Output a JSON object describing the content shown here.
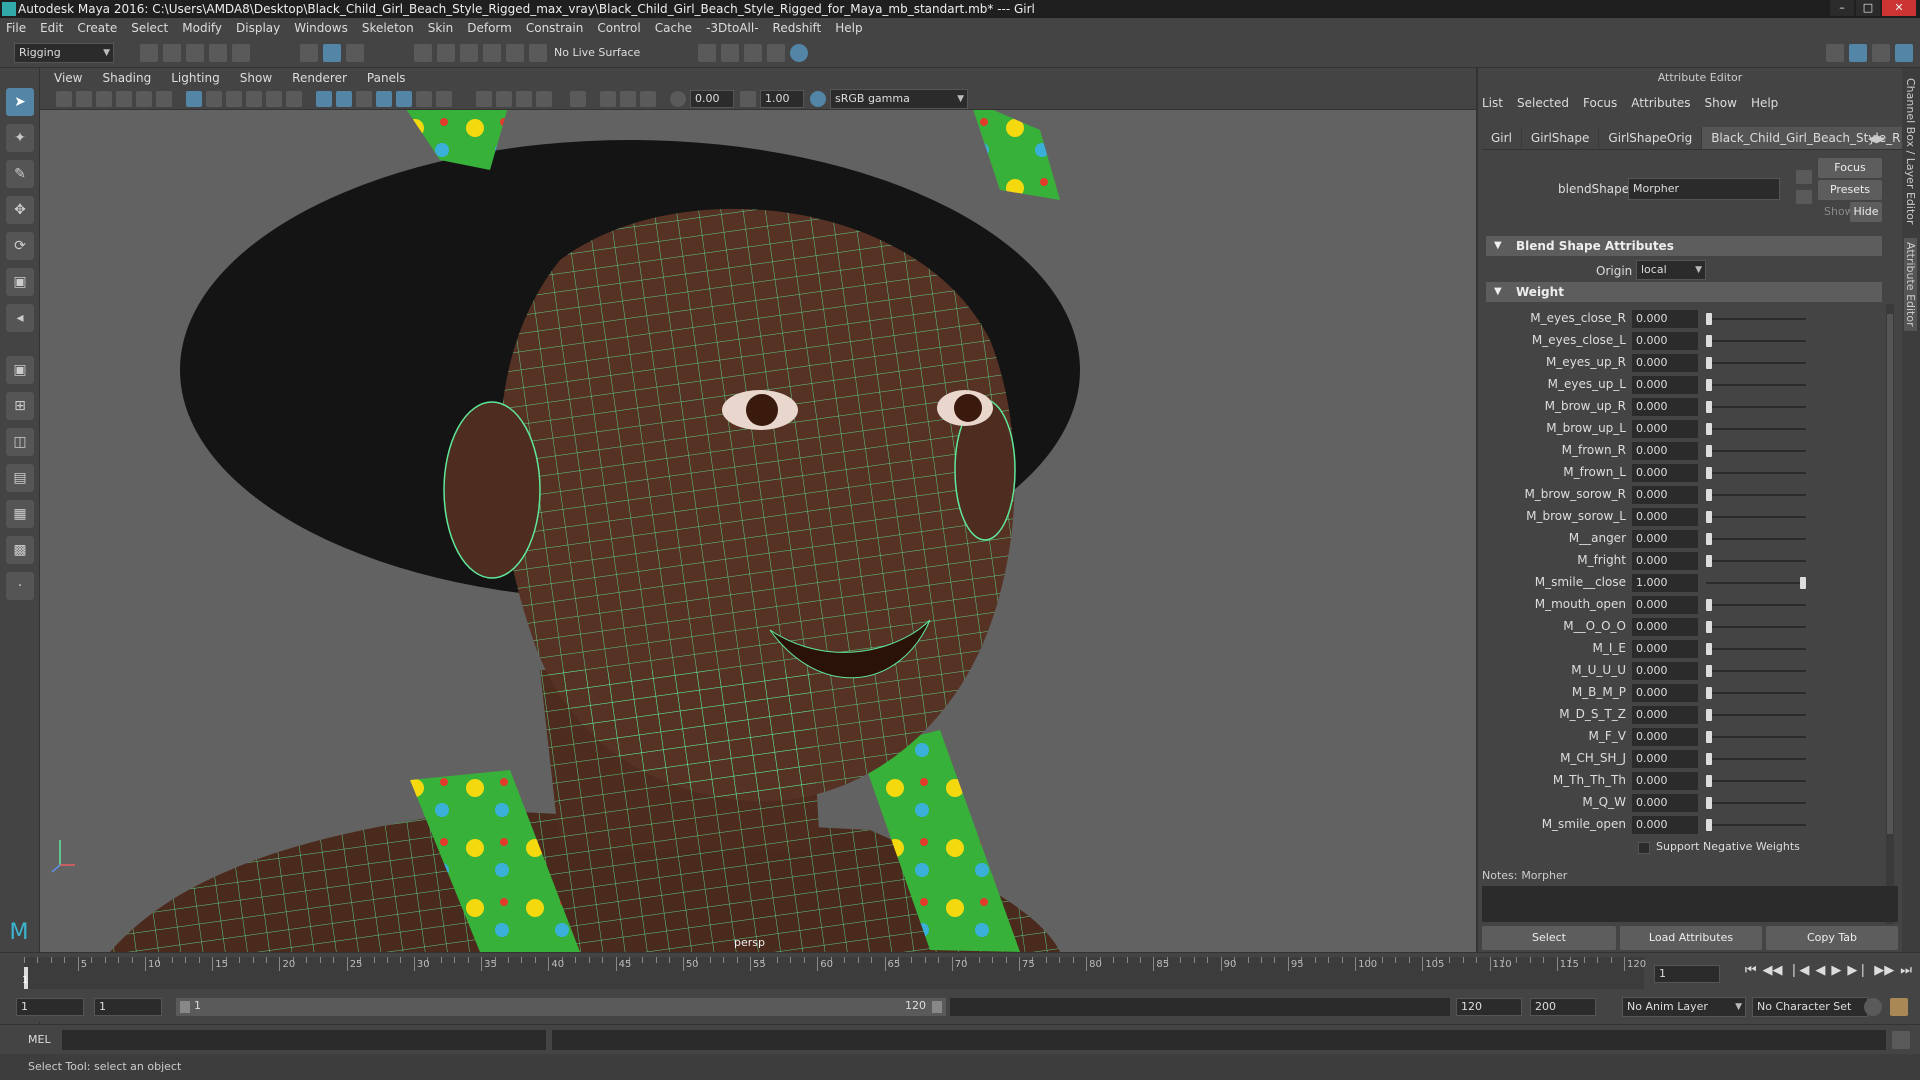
{
  "window": {
    "title": "Autodesk Maya 2016: C:\\Users\\AMDA8\\Desktop\\Black_Child_Girl_Beach_Style_Rigged_max_vray\\Black_Child_Girl_Beach_Style_Rigged_for_Maya_mb_standart.mb*   ---   Girl"
  },
  "menubar": [
    "File",
    "Edit",
    "Create",
    "Select",
    "Modify",
    "Display",
    "Windows",
    "Skeleton",
    "Skin",
    "Deform",
    "Constrain",
    "Control",
    "Cache",
    "-3DtoAll-",
    "Redshift",
    "Help"
  ],
  "shelf": {
    "mode": "Rigging",
    "live_surface": "No Live Surface"
  },
  "viewport": {
    "menu": [
      "View",
      "Shading",
      "Lighting",
      "Show",
      "Renderer",
      "Panels"
    ],
    "exposure": "0.00",
    "gamma": "1.00",
    "color_space": "sRGB gamma",
    "camera": "persp"
  },
  "attribute_editor": {
    "header": "Attribute Editor",
    "menu": [
      "List",
      "Selected",
      "Focus",
      "Attributes",
      "Show",
      "Help"
    ],
    "tabs": [
      "Girl",
      "GirlShape",
      "GirlShapeOrig",
      "Black_Child_Girl_Beach_Style_R"
    ],
    "focus_label": "Focus",
    "presets_label": "Presets",
    "show_label": "Show",
    "hide_label": "Hide",
    "node_type_label": "blendShape:",
    "node_name": "Morpher",
    "section_blend": "Blend Shape Attributes",
    "origin_label": "Origin",
    "origin_value": "local",
    "section_weight": "Weight",
    "weights": [
      {
        "name": "M_eyes_close_R",
        "value": "0.000",
        "level": 0
      },
      {
        "name": "M_eyes_close_L",
        "value": "0.000",
        "level": 0
      },
      {
        "name": "M_eyes_up_R",
        "value": "0.000",
        "level": 0
      },
      {
        "name": "M_eyes_up_L",
        "value": "0.000",
        "level": 0
      },
      {
        "name": "M_brow_up_R",
        "value": "0.000",
        "level": 0
      },
      {
        "name": "M_brow_up_L",
        "value": "0.000",
        "level": 0
      },
      {
        "name": "M_frown_R",
        "value": "0.000",
        "level": 0
      },
      {
        "name": "M_frown_L",
        "value": "0.000",
        "level": 0
      },
      {
        "name": "M_brow_sorow_R",
        "value": "0.000",
        "level": 0
      },
      {
        "name": "M_brow_sorow_L",
        "value": "0.000",
        "level": 0
      },
      {
        "name": "M__anger",
        "value": "0.000",
        "level": 0
      },
      {
        "name": "M_fright",
        "value": "0.000",
        "level": 0
      },
      {
        "name": "M_smile__close",
        "value": "1.000",
        "level": 1
      },
      {
        "name": "M_mouth_open",
        "value": "0.000",
        "level": 0
      },
      {
        "name": "M__O_O_O",
        "value": "0.000",
        "level": 0
      },
      {
        "name": "M_I_E",
        "value": "0.000",
        "level": 0
      },
      {
        "name": "M_U_U_U",
        "value": "0.000",
        "level": 0
      },
      {
        "name": "M_B_M_P",
        "value": "0.000",
        "level": 0
      },
      {
        "name": "M_D_S_T_Z",
        "value": "0.000",
        "level": 0
      },
      {
        "name": "M_F_V",
        "value": "0.000",
        "level": 0
      },
      {
        "name": "M_CH_SH_J",
        "value": "0.000",
        "level": 0
      },
      {
        "name": "M_Th_Th_Th",
        "value": "0.000",
        "level": 0
      },
      {
        "name": "M_Q_W",
        "value": "0.000",
        "level": 0
      },
      {
        "name": "M_smile_open",
        "value": "0.000",
        "level": 0
      }
    ],
    "support_negative": "Support Negative Weights",
    "notes_label": "Notes:",
    "notes_value": "Morpher",
    "bottom_buttons": [
      "Select",
      "Load Attributes",
      "Copy Tab"
    ],
    "side_tabs": [
      "Channel Box / Layer Editor",
      "Attribute Editor"
    ]
  },
  "timeline": {
    "ticks": [
      "5",
      "10",
      "15",
      "20",
      "25",
      "30",
      "35",
      "40",
      "45",
      "50",
      "55",
      "60",
      "65",
      "70",
      "75",
      "80",
      "85",
      "90",
      "95",
      "100",
      "105",
      "110",
      "115",
      "120"
    ],
    "current_frame": "1",
    "current_time_field": "1"
  },
  "range": {
    "start": "1",
    "start_inner": "1",
    "slider_start": "1",
    "slider_end": "120",
    "end_inner": "120",
    "end": "200",
    "anim_layer": "No Anim Layer",
    "char_set": "No Character Set"
  },
  "cmdline": {
    "label": "MEL"
  },
  "status": {
    "text": "Select Tool: select an object"
  }
}
